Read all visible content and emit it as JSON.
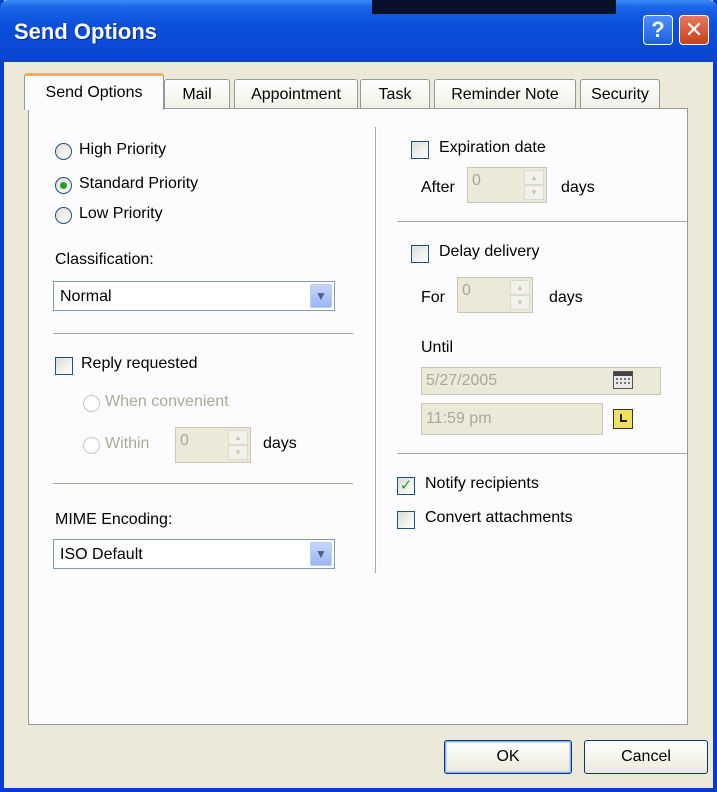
{
  "window": {
    "title": "Send Options"
  },
  "titlebar": {
    "help_icon": "?",
    "close_icon": "✕"
  },
  "tabs": [
    {
      "label": "Send Options",
      "active": true
    },
    {
      "label": "Mail"
    },
    {
      "label": "Appointment"
    },
    {
      "label": "Task"
    },
    {
      "label": "Reminder Note"
    },
    {
      "label": "Security"
    }
  ],
  "priority": {
    "high": "High Priority",
    "standard": "Standard Priority",
    "low": "Low Priority",
    "selected": "standard"
  },
  "classification": {
    "label": "Classification:",
    "value": "Normal"
  },
  "reply": {
    "label": "Reply requested",
    "when_convenient": "When convenient",
    "within": "Within",
    "within_value": "0",
    "days": "days"
  },
  "mime": {
    "label": "MIME Encoding:",
    "value": "ISO Default"
  },
  "expiration": {
    "label": "Expiration date",
    "after": "After",
    "value": "0",
    "days": "days"
  },
  "delay": {
    "label": "Delay delivery",
    "for": "For",
    "value": "0",
    "days": "days",
    "until": "Until",
    "date": "5/27/2005",
    "time": "11:59 pm"
  },
  "notify": {
    "label": "Notify recipients",
    "checked": true
  },
  "convert": {
    "label": "Convert attachments",
    "checked": false
  },
  "buttons": {
    "ok": "OK",
    "cancel": "Cancel"
  },
  "colors": {
    "title_bar": "#0a4ad6",
    "active_tab_accent": "#f5b24a",
    "check_green": "#21a121"
  }
}
